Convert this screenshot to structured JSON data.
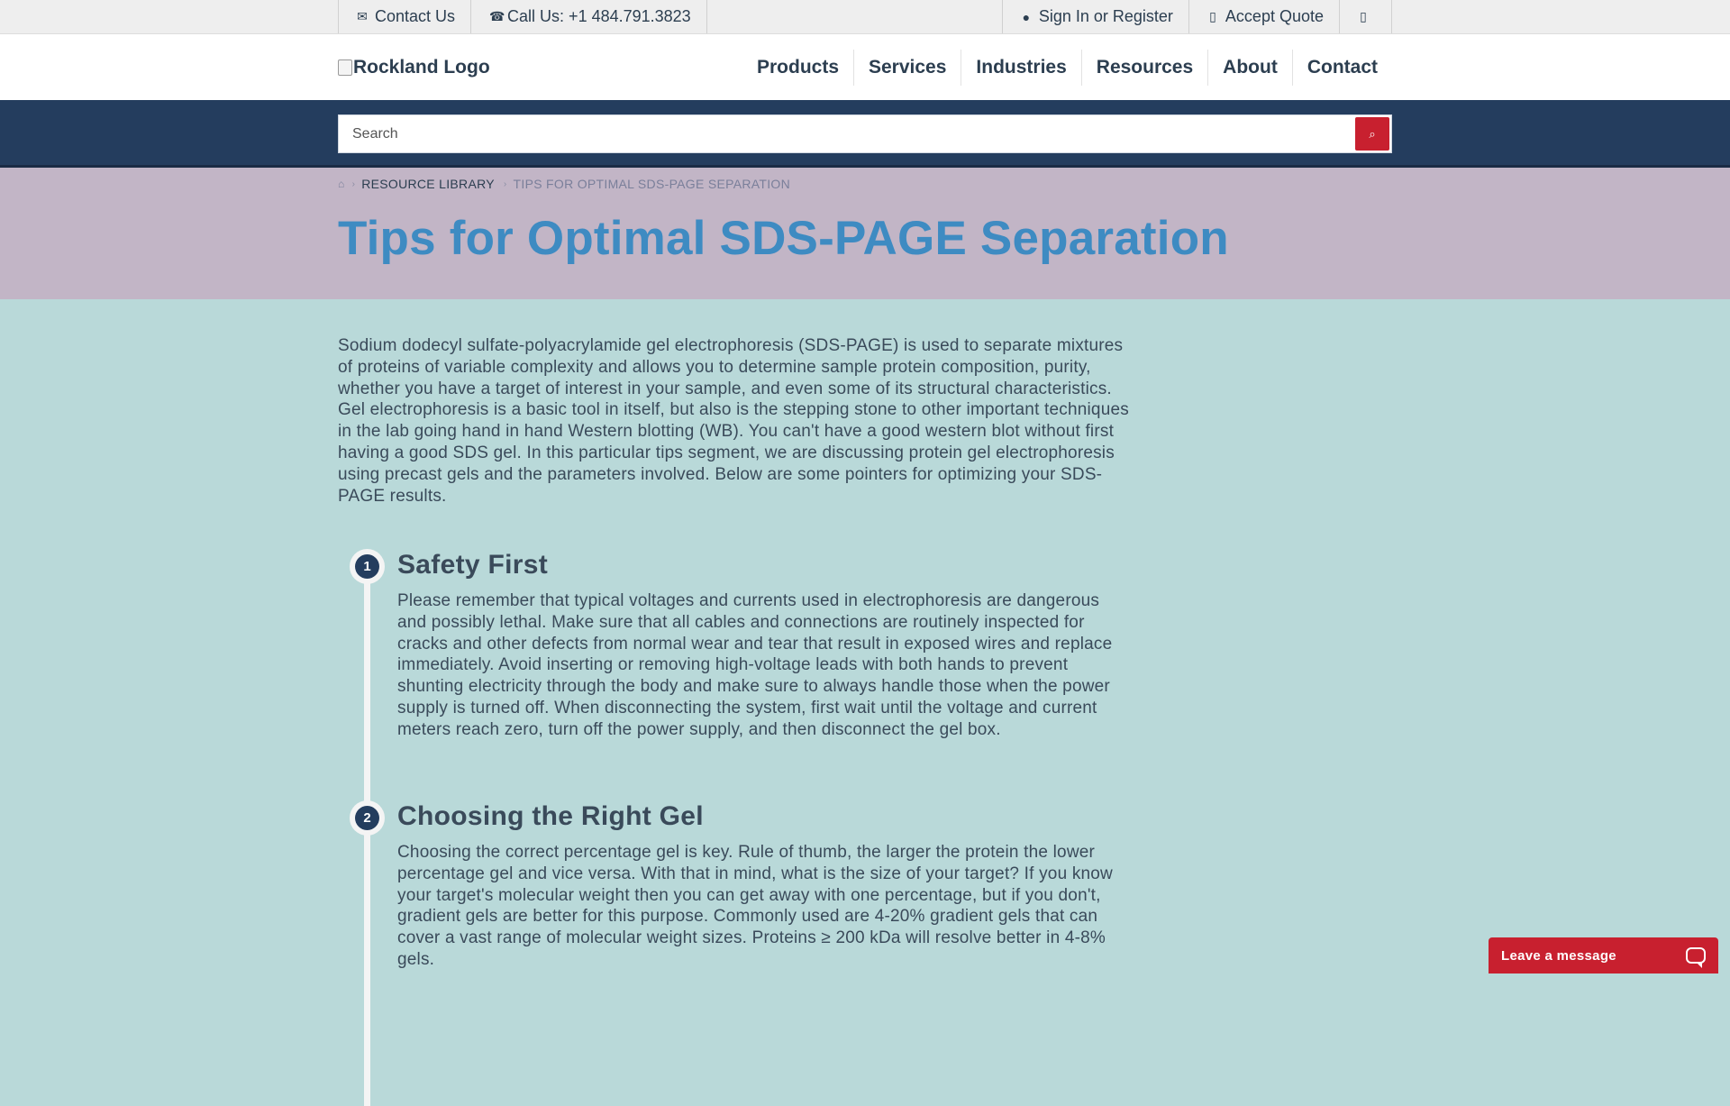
{
  "utility": {
    "left": [
      {
        "label": "Contact Us",
        "icon": "envelope-icon"
      },
      {
        "label": "Call Us: +1 484.791.3823",
        "icon": "phone-icon"
      }
    ],
    "right": [
      {
        "label": "Sign In or Register",
        "icon": "user-icon"
      },
      {
        "label": "Accept Quote",
        "icon": "document-icon"
      },
      {
        "label": "",
        "icon": "cart-icon"
      }
    ]
  },
  "header": {
    "logo_alt": "Rockland Logo",
    "nav": [
      "Products",
      "Services",
      "Industries",
      "Resources",
      "About",
      "Contact"
    ]
  },
  "search": {
    "placeholder": "Search",
    "button_icon": "search-icon"
  },
  "breadcrumb": {
    "home_icon": "home-icon",
    "items": [
      "RESOURCE LIBRARY",
      "TIPS FOR OPTIMAL SDS-PAGE SEPARATION"
    ]
  },
  "page": {
    "title": "Tips for Optimal SDS-PAGE Separation",
    "intro": "Sodium dodecyl sulfate-polyacrylamide gel electrophoresis (SDS-PAGE) is used to separate mixtures of proteins of variable complexity and allows you to determine sample protein composition, purity, whether you have a target of interest in your sample, and even some of its structural characteristics. Gel electrophoresis is a basic tool in itself, but also is the stepping stone to other important techniques in the lab going hand in hand Western blotting (WB). You can't have a good western blot without first having a good SDS gel. In this particular tips segment, we are discussing protein gel electrophoresis using precast gels and the parameters involved. Below are some pointers for optimizing your SDS-PAGE results."
  },
  "steps": [
    {
      "number": "1",
      "title": "Safety First",
      "body": "Please remember that typical voltages and currents used in electrophoresis are dangerous and possibly lethal. Make sure that all cables and connections are routinely inspected for cracks and other defects from normal wear and tear that result in exposed wires and replace immediately. Avoid inserting or removing high-voltage leads with both hands to prevent shunting electricity through the body and make sure to always handle those when the power supply is turned off. When disconnecting the system, first wait until the voltage and current meters reach zero, turn off the power supply, and then disconnect the gel box."
    },
    {
      "number": "2",
      "title": "Choosing the Right Gel",
      "body": "Choosing the correct percentage gel is key. Rule of thumb, the larger the protein the lower percentage gel and vice versa. With that in mind, what is the size of your target? If you know your target's molecular weight then you can get away with one percentage, but if you don't, gradient gels are better for this purpose. Commonly used are 4-20% gradient gels that can cover a vast range of molecular weight sizes. Proteins ≥ 200 kDa will resolve better in 4-8% gels."
    }
  ],
  "chat": {
    "label": "Leave a message",
    "icon": "chat-bubble-icon"
  },
  "colors": {
    "navy": "#243d5e",
    "accent_red": "#c8202f",
    "title_blue": "#3e8bc2",
    "hero_bg": "#c2b5c6",
    "content_bg": "#b9d9d9"
  }
}
